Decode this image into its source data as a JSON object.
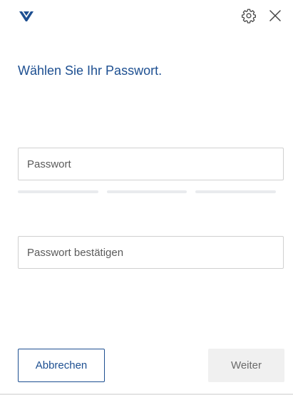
{
  "header": {
    "logo_icon": "brand-logo-icon",
    "settings_icon": "gear-icon",
    "close_icon": "close-icon",
    "brand_color": "#1d4f91"
  },
  "title": "Wählen Sie Ihr Passwort.",
  "password_field": {
    "placeholder": "Passwort",
    "value": ""
  },
  "strength_meter": {
    "segments": 3,
    "filled": 0
  },
  "confirm_field": {
    "placeholder": "Passwort bestätigen",
    "value": ""
  },
  "buttons": {
    "cancel_label": "Abbrechen",
    "next_label": "Weiter"
  }
}
